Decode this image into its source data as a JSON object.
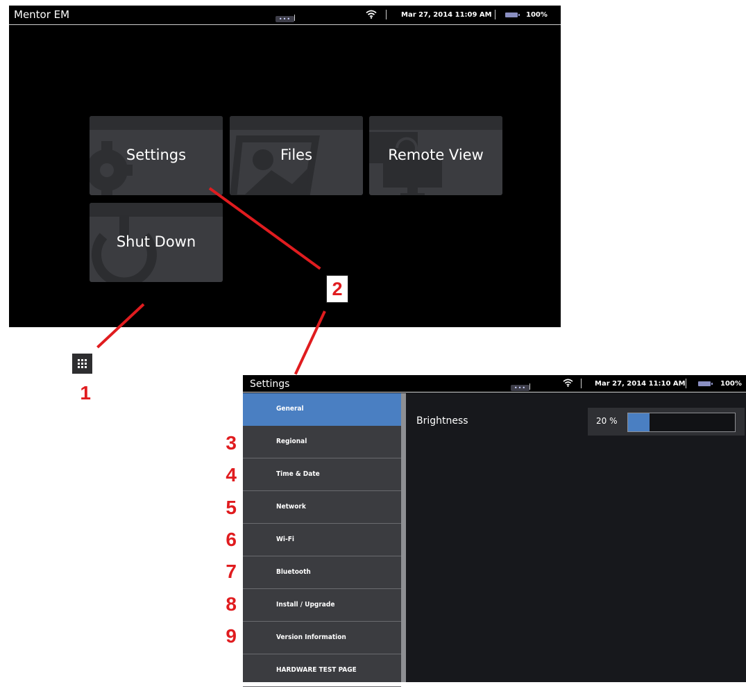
{
  "home": {
    "title": "Mentor EM",
    "more_dots": "•••",
    "datetime": "Mar 27, 2014  11:09 AM",
    "battery": "100%",
    "tiles": [
      {
        "label": "Settings",
        "icon": "gear-icon"
      },
      {
        "label": "Files",
        "icon": "image-icon"
      },
      {
        "label": "Remote View",
        "icon": "monitor-icon"
      },
      {
        "label": "Shut Down",
        "icon": "power-icon"
      }
    ]
  },
  "callouts": [
    "1",
    "2",
    "3",
    "4",
    "5",
    "6",
    "7",
    "8",
    "9"
  ],
  "apps_icon": "grid-icon",
  "settings": {
    "title": "Settings",
    "more_dots": "•••",
    "datetime": "Mar 27, 2014  11:10 AM",
    "battery": "100%",
    "menu": [
      "General",
      "Regional",
      "Time & Date",
      "Network",
      "Wi-Fi",
      "Bluetooth",
      "Install / Upgrade",
      "Version Information",
      "HARDWARE TEST PAGE"
    ],
    "active_index": 0,
    "brightness_label": "Brightness",
    "brightness_value": "20 %",
    "brightness_level": 0.2
  },
  "colors": {
    "accent": "#4a7fc2",
    "callout": "#e01c1f",
    "tile": "#3b3c40"
  }
}
